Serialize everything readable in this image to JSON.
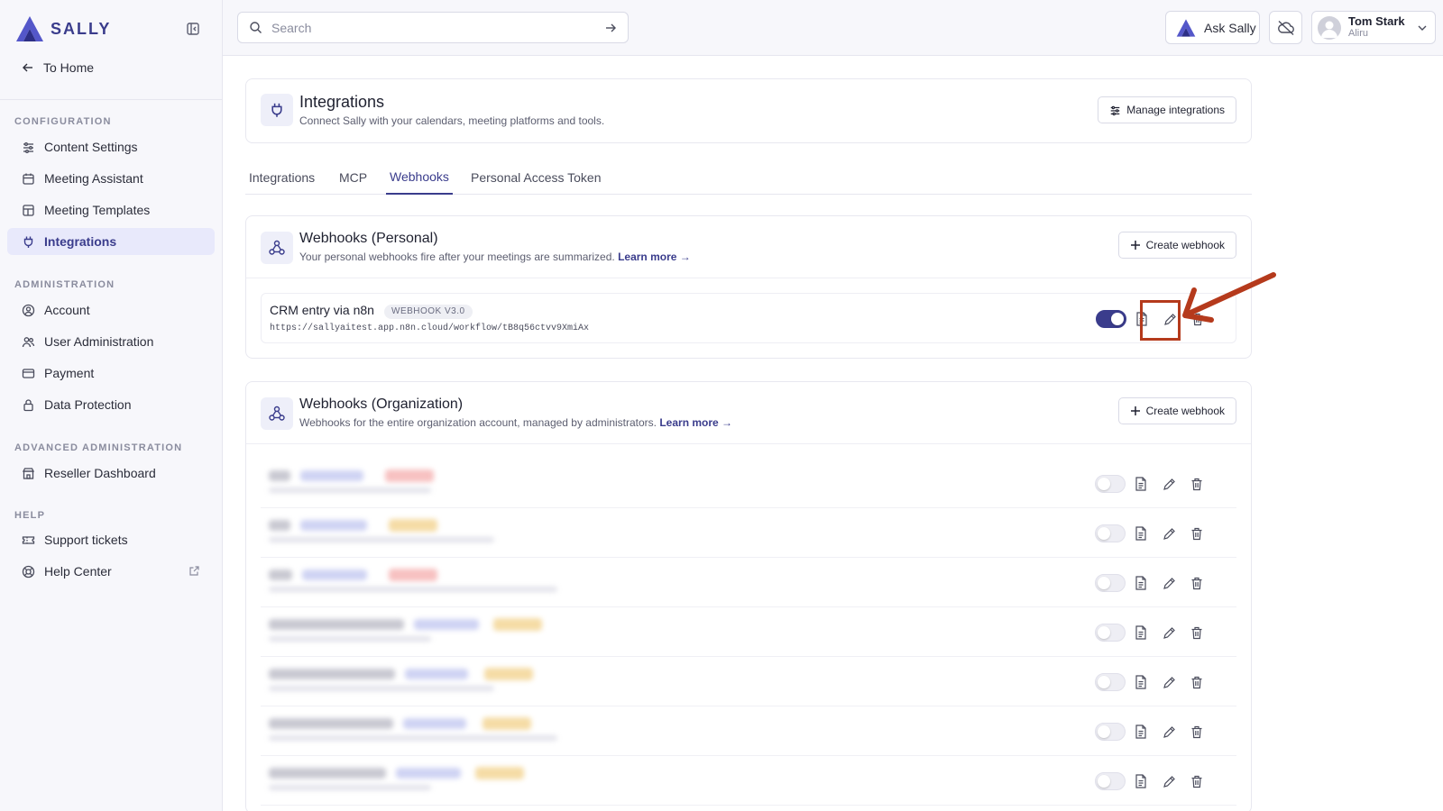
{
  "brand": {
    "name": "SALLY"
  },
  "sidebar": {
    "home": "To Home",
    "sections": [
      {
        "title": "CONFIGURATION",
        "items": [
          "Content Settings",
          "Meeting Assistant",
          "Meeting Templates",
          "Integrations"
        ]
      },
      {
        "title": "ADMINISTRATION",
        "items": [
          "Account",
          "User Administration",
          "Payment",
          "Data Protection"
        ]
      },
      {
        "title": "ADVANCED ADMINISTRATION",
        "items": [
          "Reseller Dashboard"
        ]
      },
      {
        "title": "HELP",
        "items": [
          "Support tickets",
          "Help Center"
        ]
      }
    ],
    "active": "Integrations"
  },
  "topbar": {
    "search_placeholder": "Search",
    "ask_label": "Ask Sally",
    "user_name": "Tom Stark",
    "user_org": "Aliru"
  },
  "header": {
    "title": "Integrations",
    "subtitle": "Connect Sally with your calendars, meeting platforms and tools.",
    "manage_label": "Manage integrations"
  },
  "tabs": [
    "Integrations",
    "MCP",
    "Webhooks",
    "Personal Access Token"
  ],
  "active_tab": "Webhooks",
  "personal": {
    "title": "Webhooks (Personal)",
    "subtitle": "Your personal webhooks fire after your meetings are summarized.",
    "learn_more": "Learn more →",
    "create_label": "Create webhook",
    "webhook": {
      "name": "CRM entry via n8n",
      "badge": "WEBHOOK V3.0",
      "url": "https://sallyaitest.app.n8n.cloud/workflow/tB8q56ctvv9XmiAx",
      "enabled": true
    }
  },
  "organization": {
    "title": "Webhooks (Organization)",
    "subtitle": "Webhooks for the entire organization account, managed by administrators.",
    "learn_more": "Learn more →",
    "create_label": "Create webhook"
  },
  "colors": {
    "accent": "#3a3c8c",
    "annotation": "#b53a1c"
  }
}
